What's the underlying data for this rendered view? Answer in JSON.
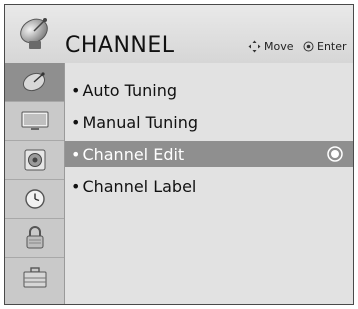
{
  "header": {
    "title": "CHANNEL",
    "icon": "satellite-dish-icon",
    "hints": {
      "move_label": "Move",
      "enter_label": "Enter"
    }
  },
  "sidebar": {
    "items": [
      {
        "icon": "satellite-icon",
        "active": true
      },
      {
        "icon": "tv-screen-icon",
        "active": false
      },
      {
        "icon": "speaker-icon",
        "active": false
      },
      {
        "icon": "clock-icon",
        "active": false
      },
      {
        "icon": "lock-icon",
        "active": false
      },
      {
        "icon": "toolbox-icon",
        "active": false
      }
    ]
  },
  "menu": {
    "bullet": "•",
    "items": [
      {
        "label": "Auto Tuning",
        "selected": false
      },
      {
        "label": "Manual Tuning",
        "selected": false
      },
      {
        "label": "Channel Edit",
        "selected": true
      },
      {
        "label": "Channel Label",
        "selected": false
      }
    ]
  },
  "colors": {
    "selection": "#8f8f8f",
    "panel": "#e2e2e2",
    "sidebar": "#c9c9c9"
  }
}
